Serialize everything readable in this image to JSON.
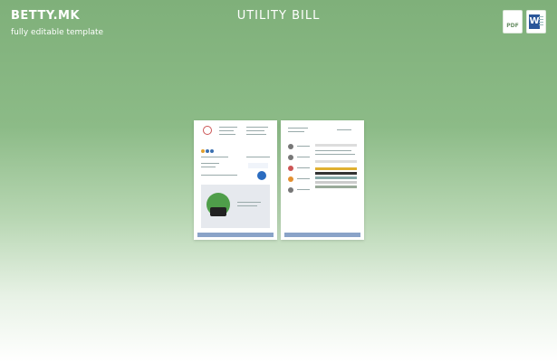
{
  "header": {
    "brand": "BETTY.MK",
    "tagline": "fully editable template",
    "title": "UTILITY BILL"
  },
  "file_formats": [
    {
      "label": "PDF",
      "icon": "pdf-file-icon"
    },
    {
      "label": "W",
      "icon": "word-file-icon"
    }
  ],
  "colors": {
    "background_top": "#7fb07a",
    "background_bottom": "#ffffff",
    "word_blue": "#2b579a",
    "footer_blue": "#8aa3c8"
  }
}
